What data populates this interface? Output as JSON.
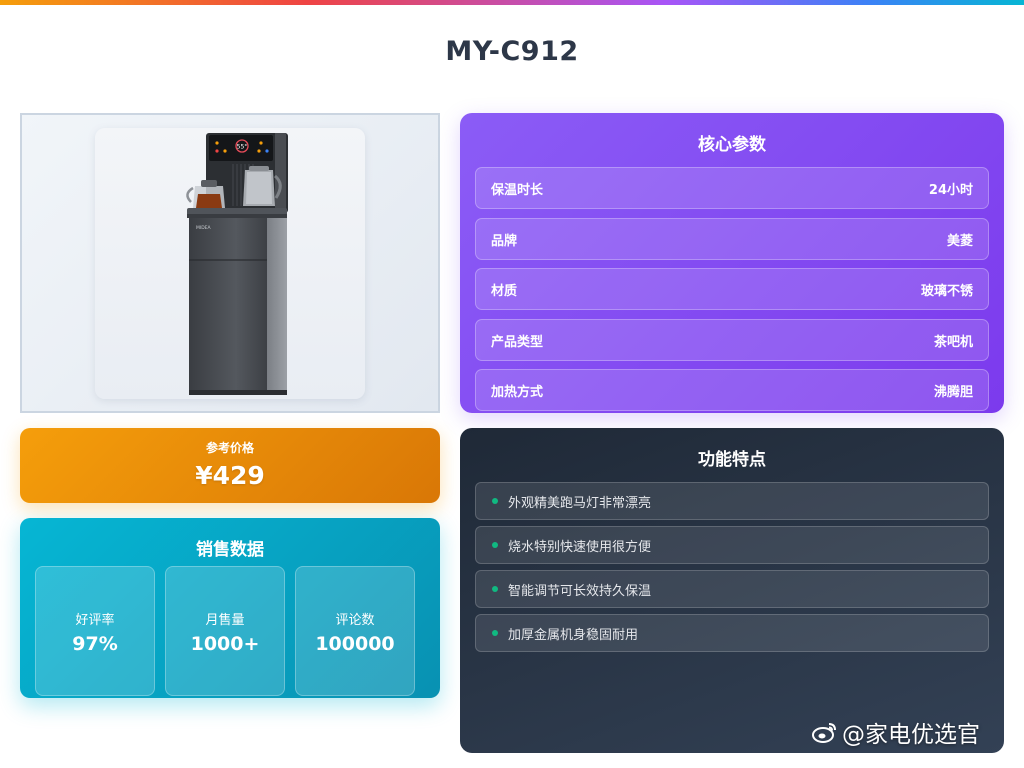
{
  "page": {
    "title": "MY-C912"
  },
  "colors": {
    "specs_bg": "#8b5cf6",
    "price_bg": "#f59e0b",
    "sales_bg": "#06b6d4",
    "features_bg": "#1f2937",
    "feature_dot": "#10b981",
    "title_text": "#2d3748"
  },
  "product_image": {
    "icon": "water-dispenser-image",
    "brand_text": "MIDEA",
    "display_temp": "55°"
  },
  "specs": {
    "heading": "核心参数",
    "rows": [
      {
        "label": "保温时长",
        "value": "24小时"
      },
      {
        "label": "品牌",
        "value": "美菱"
      },
      {
        "label": "材质",
        "value": "玻璃不锈"
      },
      {
        "label": "产品类型",
        "value": "茶吧机"
      },
      {
        "label": "加热方式",
        "value": "沸腾胆"
      }
    ]
  },
  "price": {
    "label": "参考价格",
    "value": "¥429"
  },
  "sales": {
    "heading": "销售数据",
    "items": [
      {
        "label": "好评率",
        "value": "97%"
      },
      {
        "label": "月售量",
        "value": "1000+"
      },
      {
        "label": "评论数",
        "value": "100000"
      }
    ]
  },
  "features": {
    "heading": "功能特点",
    "items": [
      "外观精美跑马灯非常漂亮",
      "烧水特别快速使用很方便",
      "智能调节可长效持久保温",
      "加厚金属机身稳固耐用"
    ]
  },
  "watermark": {
    "icon": "weibo-icon",
    "text": "@家电优选官"
  }
}
